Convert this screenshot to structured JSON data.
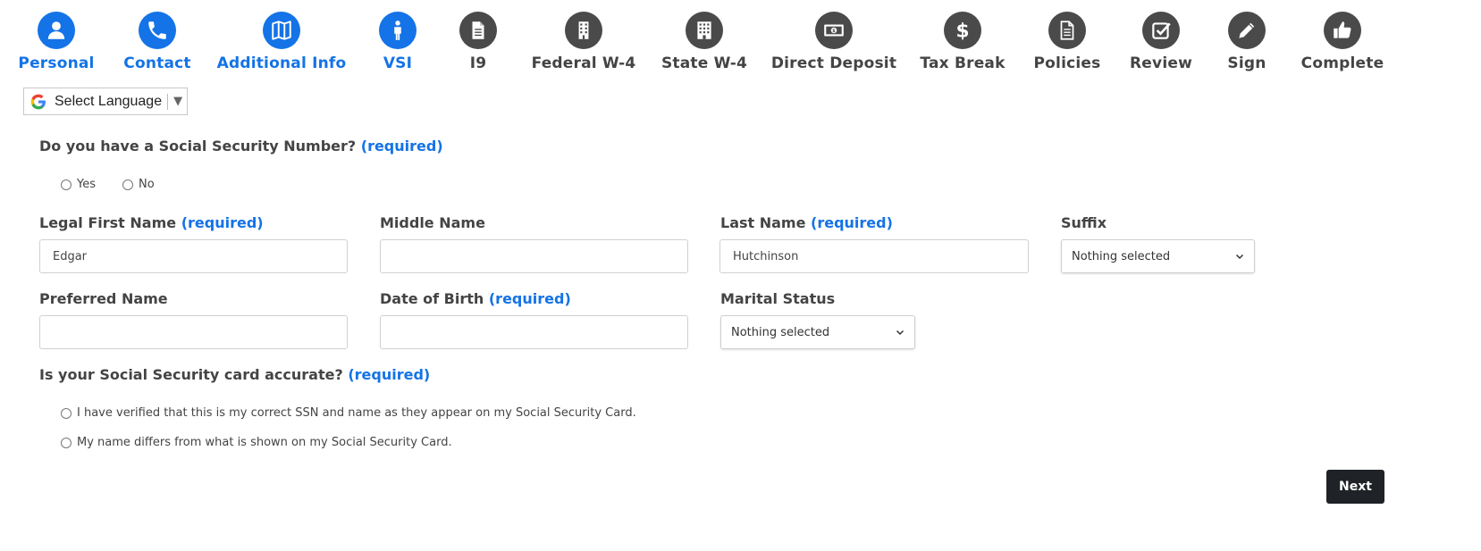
{
  "steps": [
    {
      "label": "Personal",
      "icon": "user-icon",
      "status": "done"
    },
    {
      "label": "Contact",
      "icon": "phone-icon",
      "status": "done"
    },
    {
      "label": "Additional Info",
      "icon": "map-icon",
      "status": "done"
    },
    {
      "label": "VSI",
      "icon": "person-icon",
      "status": "done"
    },
    {
      "label": "I9",
      "icon": "document-icon",
      "status": "todo"
    },
    {
      "label": "Federal W-4",
      "icon": "building-icon",
      "status": "todo"
    },
    {
      "label": "State W-4",
      "icon": "building-icon",
      "status": "todo"
    },
    {
      "label": "Direct Deposit",
      "icon": "money-icon",
      "status": "todo"
    },
    {
      "label": "Tax Break",
      "icon": "dollar-icon",
      "status": "todo"
    },
    {
      "label": "Policies",
      "icon": "document-icon",
      "status": "todo"
    },
    {
      "label": "Review",
      "icon": "checkbox-icon",
      "status": "todo"
    },
    {
      "label": "Sign",
      "icon": "pencil-icon",
      "status": "todo"
    },
    {
      "label": "Complete",
      "icon": "thumbs-up-icon",
      "status": "todo"
    }
  ],
  "language": {
    "label": "Select Language",
    "arrow": "▼"
  },
  "form": {
    "required_text": "(required)",
    "ssn_question": "Do you have a Social Security Number?",
    "ssn_options": [
      "Yes",
      "No"
    ],
    "first_name": {
      "label": "Legal First Name",
      "value": "Edgar"
    },
    "middle_name": {
      "label": "Middle Name",
      "value": ""
    },
    "last_name": {
      "label": "Last Name",
      "value": "Hutchinson"
    },
    "suffix": {
      "label": "Suffix",
      "value": "Nothing selected"
    },
    "preferred_name": {
      "label": "Preferred Name",
      "value": ""
    },
    "dob": {
      "label": "Date of Birth",
      "value": ""
    },
    "marital_status": {
      "label": "Marital Status",
      "value": "Nothing selected"
    },
    "card_question": "Is your Social Security card accurate?",
    "card_options": [
      "I have verified that this is my correct SSN and name as they appear on my Social Security Card.",
      "My name differs from what is shown on my Social Security Card."
    ]
  },
  "next_button": "Next",
  "colors": {
    "accent": "#1473e6",
    "inactive": "#4a4a4a",
    "button": "#1f2226"
  }
}
